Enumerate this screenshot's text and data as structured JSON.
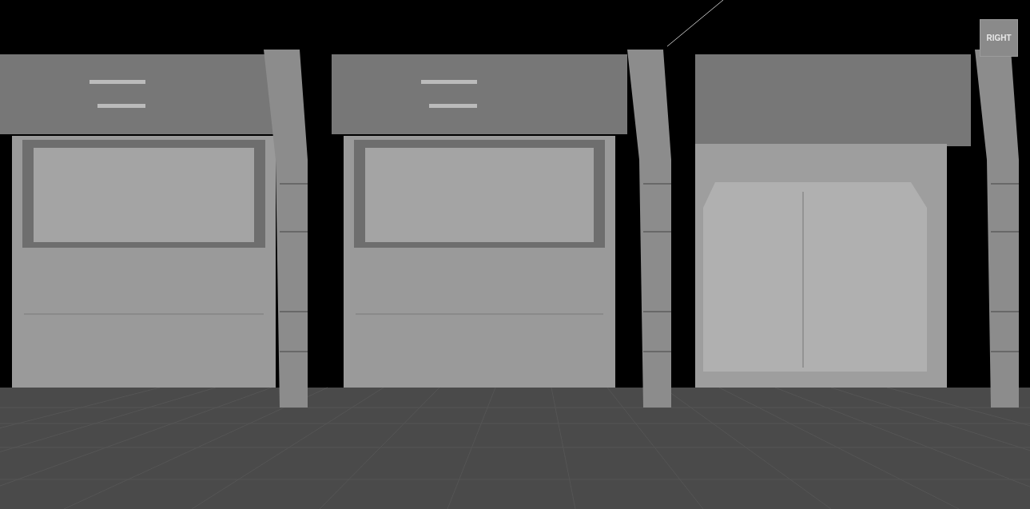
{
  "viewport": {
    "view_cube": {
      "label": "RIGHT"
    }
  }
}
